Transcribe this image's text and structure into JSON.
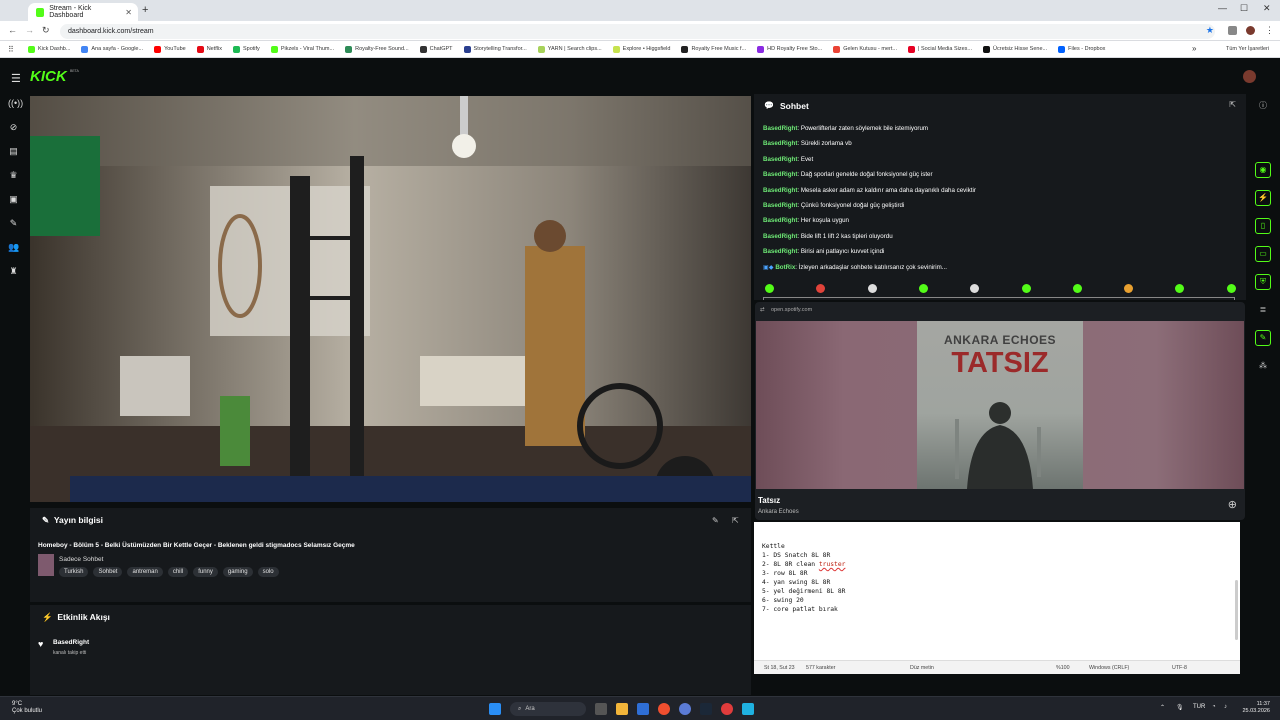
{
  "browser": {
    "tab_title": "Stream - Kick Dashboard",
    "url": "dashboard.kick.com/stream",
    "bookmarks": [
      {
        "label": "Kick Dashb...",
        "color": "#53fc18"
      },
      {
        "label": "Ana sayfa - Google...",
        "color": "#4285f4"
      },
      {
        "label": "YouTube",
        "color": "#ff0000"
      },
      {
        "label": "Netflix",
        "color": "#e50914"
      },
      {
        "label": "Spotify",
        "color": "#1db954"
      },
      {
        "label": "Pikzels - Viral Thum...",
        "color": "#53fc18"
      },
      {
        "label": "Royalty-Free Sound...",
        "color": "#2e8b57"
      },
      {
        "label": "ChatGPT",
        "color": "#333333"
      },
      {
        "label": "Storytelling Transfor...",
        "color": "#2a3f8f"
      },
      {
        "label": "YARN | Search clips...",
        "color": "#a7d25a"
      },
      {
        "label": "Explore • Higgsfield",
        "color": "#c6e24e"
      },
      {
        "label": "Royalty Free Music f...",
        "color": "#222222"
      },
      {
        "label": "HD Royalty Free Sto...",
        "color": "#8a2be2"
      },
      {
        "label": "Gelen Kutusu - mert...",
        "color": "#ea4335"
      },
      {
        "label": "| Social Media Sizes...",
        "color": "#e60023"
      },
      {
        "label": "Ücretsiz Hisse Sene...",
        "color": "#111111"
      },
      {
        "label": "Files - Dropbox",
        "color": "#0061fe"
      }
    ],
    "all_bookmarks": "Tüm Yer İşaretleri"
  },
  "kick": {
    "logo": "KICK",
    "beta": "BETA"
  },
  "stream_info": {
    "heading": "Yayın bilgisi",
    "title": "Homeboy - Bölüm 5 - Belki Üstümüzden Bir Kettle Geçer - Beklenen geldi stigmadocs Selamsız Geçme",
    "category": "Sadece Sohbet",
    "tags": [
      "Turkish",
      "Sohbet",
      "antreman",
      "chill",
      "funny",
      "gaming",
      "solo"
    ]
  },
  "activity": {
    "heading": "Etkinlik Akışı",
    "user": "BasedRight",
    "text": "kanalı takip etti"
  },
  "chat": {
    "heading": "Sohbet",
    "messages": [
      {
        "user": "BasedRight",
        "text": ": Powerlifterlar zaten söylemek bile istemiyorum"
      },
      {
        "user": "BasedRight",
        "text": ": Sürekli zorlama vb"
      },
      {
        "user": "BasedRight",
        "text": ": Evet"
      },
      {
        "user": "BasedRight",
        "text": ": Dağ sporlari genelde doğal fonksiyonel güç ister"
      },
      {
        "user": "BasedRight",
        "text": ": Mesela asker adam az kaldırır ama daha dayanıklı daha ceviktir"
      },
      {
        "user": "BasedRight",
        "text": ": Çünkü fonksiyonel doğal güç geliştirdi"
      },
      {
        "user": "BasedRight",
        "text": ": Her koşula uygun"
      },
      {
        "user": "BasedRight",
        "text": ": Bide lift 1 lift 2 kas tipleri oluyordu"
      },
      {
        "user": "BasedRight",
        "text": ": Birisi ani patlayıcı kuvvet içindi"
      },
      {
        "user": "BotRix",
        "text": ": İzleyen arkadaşlar sohbete katılırsanız çok sevinirim..."
      }
    ]
  },
  "spotify": {
    "url": "open.spotify.com",
    "cover_artist": "ANKARA ECHOES",
    "cover_title": "TATSIZ",
    "track": "Tatsız",
    "artist": "Ankara Echoes"
  },
  "notepad": {
    "lines": [
      "Kettle",
      "1- DS Snatch 8L 8R",
      "2- 8L 8R clean ",
      "3- row 8L 8R",
      "4- yan swing 8L 8R",
      "5- yel değirmeni 8L 8R",
      "6- swing 20",
      "7- core patlat bırak"
    ],
    "misspelled": "truster",
    "status": {
      "position": "St 18, Sut 23",
      "chars": "577 karakter",
      "format": "Düz metin",
      "zoom": "%100",
      "eol": "Windows (CRLF)",
      "encoding": "UTF-8"
    }
  },
  "taskbar": {
    "temp": "9°C",
    "weather": "Çok bulutlu",
    "search": "Ara",
    "lang": "TUR",
    "time": "11:37",
    "date": "25.03.2026"
  }
}
